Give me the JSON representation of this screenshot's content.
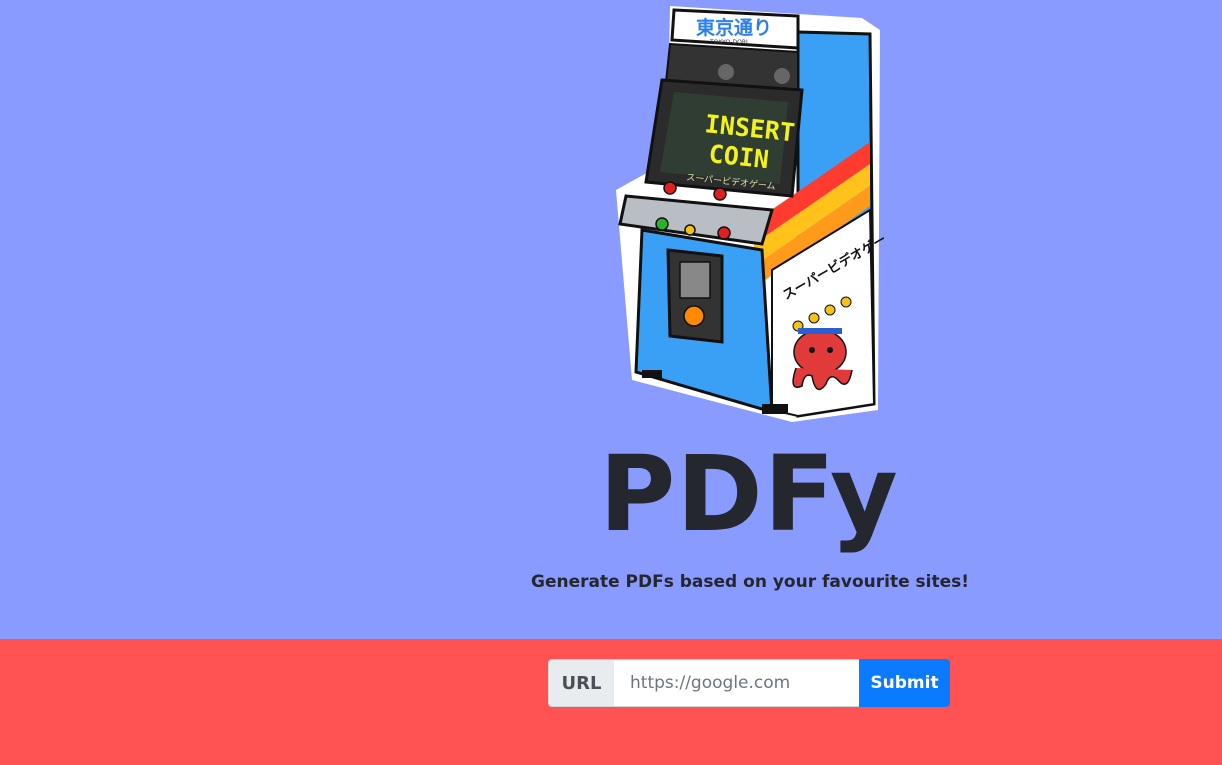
{
  "hero": {
    "logo_sign_text": "東京通り",
    "logo_sign_subtext": "TOKYO-DORI",
    "screen_line1": "INSERT",
    "screen_line2": "COIN",
    "screen_subtext": "スーパービデオゲーム",
    "side_text": "スーパービデオゲーム",
    "title": "PDFy",
    "subtitle": "Generate PDFs based on your favourite sites!"
  },
  "form": {
    "prefix_label": "URL",
    "url_placeholder": "https://google.com",
    "submit_label": "Submit"
  },
  "colors": {
    "top_background": "#8a9bff",
    "bottom_background": "#ff5353",
    "submit_button": "#0a7bff",
    "title_text": "#24272e"
  }
}
